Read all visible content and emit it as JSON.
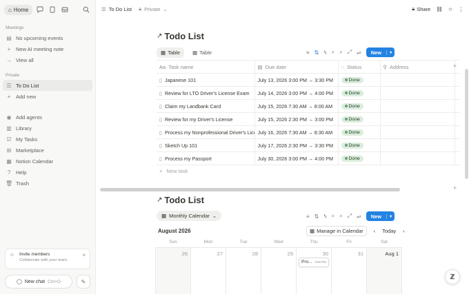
{
  "sidebar": {
    "home_label": "Home",
    "meetings_heading": "Meetings",
    "meetings_items": [
      {
        "icon": "calendar-icon",
        "glyph": "▤",
        "label": "No upcoming events"
      },
      {
        "icon": "plus-icon",
        "glyph": "+",
        "label": "New AI meeting note"
      },
      {
        "icon": "arrow-right-icon",
        "glyph": "→",
        "label": "View all"
      }
    ],
    "private_heading": "Private",
    "private_items": [
      {
        "icon": "checklist-icon",
        "glyph": "☰",
        "label": "To Do List",
        "active": true
      },
      {
        "icon": "plus-icon",
        "glyph": "+",
        "label": "Add new"
      }
    ],
    "bottom_items": [
      {
        "icon": "agent-icon",
        "glyph": "◉",
        "label": "Add agents"
      },
      {
        "icon": "library-icon",
        "glyph": "▥",
        "label": "Library"
      },
      {
        "icon": "tasks-icon",
        "glyph": "☑",
        "label": "My Tasks"
      },
      {
        "icon": "marketplace-icon",
        "glyph": "⊞",
        "label": "Marketplace"
      },
      {
        "icon": "calendar-icon",
        "glyph": "▦",
        "label": "Notion Calendar"
      },
      {
        "icon": "help-icon",
        "glyph": "?",
        "label": "Help"
      },
      {
        "icon": "trash-icon",
        "glyph": "🗑",
        "label": "Trash"
      }
    ],
    "invite": {
      "title": "Invite members",
      "subtitle": "Collaborate with your team."
    },
    "new_chat": {
      "label": "New chat",
      "shortcut": "Ctrl+O"
    }
  },
  "topbar": {
    "page": "To Do List",
    "privacy": "Private",
    "share": "Share"
  },
  "table_view": {
    "title": "Todo List",
    "tabs": [
      "Table",
      "Table"
    ],
    "new_button": "New",
    "columns": [
      "Task name",
      "Due date",
      "Status",
      "Address"
    ],
    "rows": [
      {
        "name": "Japanese 101",
        "due": "July 13, 2026 3:00 PM → 3:30 PM",
        "status": "Done"
      },
      {
        "name": "Review for LTO Driver's License Exam",
        "due": "July 14, 2026 3:00 PM → 4:00 PM",
        "status": "Done"
      },
      {
        "name": "Claim my Landbank Card",
        "due": "July 15, 2026 7:30 AM → 8:00 AM",
        "status": "Done"
      },
      {
        "name": "Review for my Driver's License",
        "due": "July 15, 2026 2:30 PM → 3:00 PM",
        "status": "Done"
      },
      {
        "name": "Process my Nonprofessional Driver's License",
        "due": "July 16, 2026 7:30 AM → 8:30 AM",
        "status": "Done"
      },
      {
        "name": "Sketch Up 101",
        "due": "July 17, 2026 2:30 PM → 3:30 PM",
        "status": "Done"
      },
      {
        "name": "Process my Passport",
        "due": "July 30, 2026 3:00 PM → 4:00 PM",
        "status": "Done"
      }
    ],
    "new_task": "New task"
  },
  "calendar_view": {
    "title": "Todo List",
    "view_label": "Monthly Calendar",
    "new_button": "New",
    "month": "August 2026",
    "manage_label": "Manage in Calendar",
    "today_label": "Today",
    "weekdays": [
      "Sun",
      "Mon",
      "Tue",
      "Wed",
      "Thu",
      "Fri",
      "Sat"
    ],
    "days": [
      "26",
      "27",
      "28",
      "29",
      "30",
      "31",
      "Aug 1"
    ],
    "event": {
      "label": "Pro...",
      "time": "3:00 PM"
    }
  }
}
